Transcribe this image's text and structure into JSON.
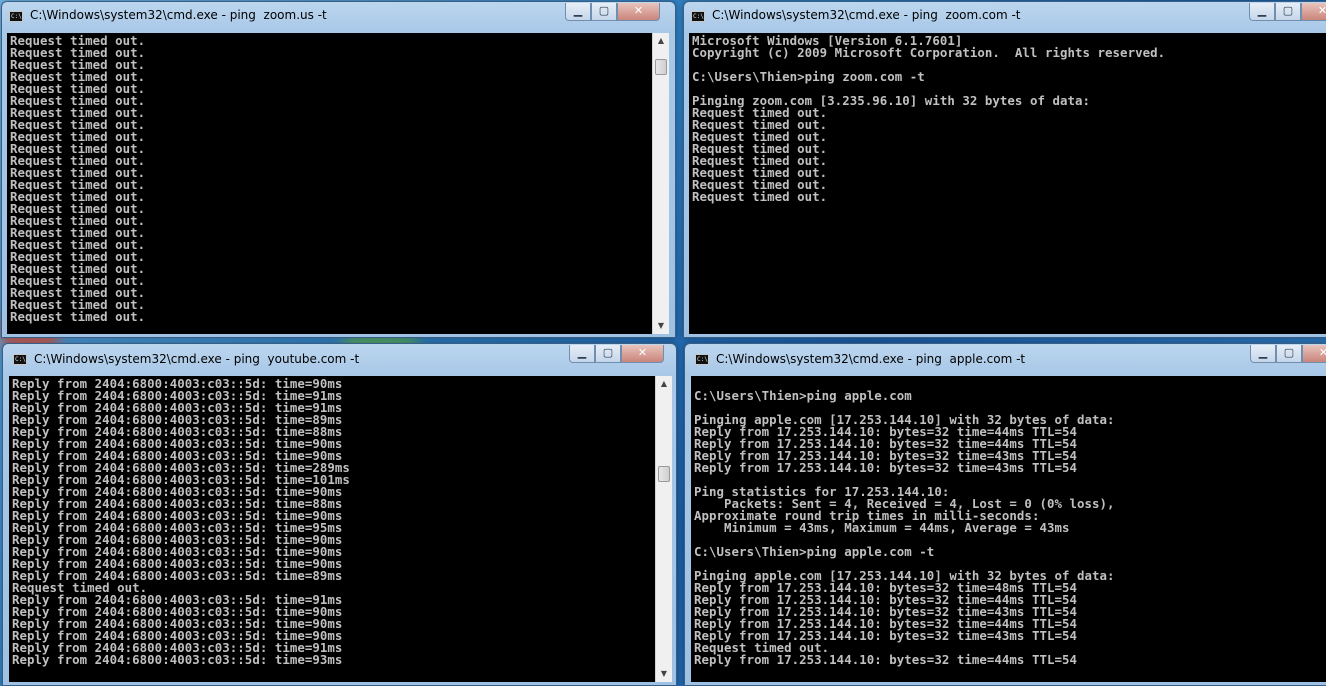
{
  "windows": {
    "w1": {
      "title": "C:\\Windows\\system32\\cmd.exe - ping  zoom.us -t",
      "lines": [
        "Request timed out.",
        "Request timed out.",
        "Request timed out.",
        "Request timed out.",
        "Request timed out.",
        "Request timed out.",
        "Request timed out.",
        "Request timed out.",
        "Request timed out.",
        "Request timed out.",
        "Request timed out.",
        "Request timed out.",
        "Request timed out.",
        "Request timed out.",
        "Request timed out.",
        "Request timed out.",
        "Request timed out.",
        "Request timed out.",
        "Request timed out.",
        "Request timed out.",
        "Request timed out.",
        "Request timed out.",
        "Request timed out.",
        "Request timed out."
      ]
    },
    "w2": {
      "title": "C:\\Windows\\system32\\cmd.exe - ping  zoom.com -t",
      "lines": [
        "Microsoft Windows [Version 6.1.7601]",
        "Copyright (c) 2009 Microsoft Corporation.  All rights reserved.",
        "",
        "C:\\Users\\Thien>ping zoom.com -t",
        "",
        "Pinging zoom.com [3.235.96.10] with 32 bytes of data:",
        "Request timed out.",
        "Request timed out.",
        "Request timed out.",
        "Request timed out.",
        "Request timed out.",
        "Request timed out.",
        "Request timed out.",
        "Request timed out."
      ]
    },
    "w3": {
      "title": "C:\\Windows\\system32\\cmd.exe - ping  youtube.com -t",
      "lines": [
        "Reply from 2404:6800:4003:c03::5d: time=90ms",
        "Reply from 2404:6800:4003:c03::5d: time=91ms",
        "Reply from 2404:6800:4003:c03::5d: time=91ms",
        "Reply from 2404:6800:4003:c03::5d: time=89ms",
        "Reply from 2404:6800:4003:c03::5d: time=88ms",
        "Reply from 2404:6800:4003:c03::5d: time=90ms",
        "Reply from 2404:6800:4003:c03::5d: time=90ms",
        "Reply from 2404:6800:4003:c03::5d: time=289ms",
        "Reply from 2404:6800:4003:c03::5d: time=101ms",
        "Reply from 2404:6800:4003:c03::5d: time=90ms",
        "Reply from 2404:6800:4003:c03::5d: time=88ms",
        "Reply from 2404:6800:4003:c03::5d: time=90ms",
        "Reply from 2404:6800:4003:c03::5d: time=95ms",
        "Reply from 2404:6800:4003:c03::5d: time=90ms",
        "Reply from 2404:6800:4003:c03::5d: time=90ms",
        "Reply from 2404:6800:4003:c03::5d: time=90ms",
        "Reply from 2404:6800:4003:c03::5d: time=89ms",
        "Request timed out.",
        "Reply from 2404:6800:4003:c03::5d: time=91ms",
        "Reply from 2404:6800:4003:c03::5d: time=90ms",
        "Reply from 2404:6800:4003:c03::5d: time=90ms",
        "Reply from 2404:6800:4003:c03::5d: time=90ms",
        "Reply from 2404:6800:4003:c03::5d: time=91ms",
        "Reply from 2404:6800:4003:c03::5d: time=93ms"
      ]
    },
    "w4": {
      "title": "C:\\Windows\\system32\\cmd.exe - ping  apple.com -t",
      "lines": [
        "",
        "C:\\Users\\Thien>ping apple.com",
        "",
        "Pinging apple.com [17.253.144.10] with 32 bytes of data:",
        "Reply from 17.253.144.10: bytes=32 time=44ms TTL=54",
        "Reply from 17.253.144.10: bytes=32 time=44ms TTL=54",
        "Reply from 17.253.144.10: bytes=32 time=43ms TTL=54",
        "Reply from 17.253.144.10: bytes=32 time=43ms TTL=54",
        "",
        "Ping statistics for 17.253.144.10:",
        "    Packets: Sent = 4, Received = 4, Lost = 0 (0% loss),",
        "Approximate round trip times in milli-seconds:",
        "    Minimum = 43ms, Maximum = 44ms, Average = 43ms",
        "",
        "C:\\Users\\Thien>ping apple.com -t",
        "",
        "Pinging apple.com [17.253.144.10] with 32 bytes of data:",
        "Reply from 17.253.144.10: bytes=32 time=48ms TTL=54",
        "Reply from 17.253.144.10: bytes=32 time=44ms TTL=54",
        "Reply from 17.253.144.10: bytes=32 time=43ms TTL=54",
        "Reply from 17.253.144.10: bytes=32 time=44ms TTL=54",
        "Reply from 17.253.144.10: bytes=32 time=43ms TTL=54",
        "Request timed out.",
        "Reply from 17.253.144.10: bytes=32 time=44ms TTL=54"
      ]
    }
  },
  "controls": {
    "minimize_glyph": "▁",
    "maximize_glyph": "▢",
    "close_glyph": "✕",
    "icon_glyph": "C:\\"
  },
  "colors": {
    "console_bg": "#000000",
    "console_fg": "#c0c0c0",
    "desktop_accent": "#2f7fc2"
  }
}
